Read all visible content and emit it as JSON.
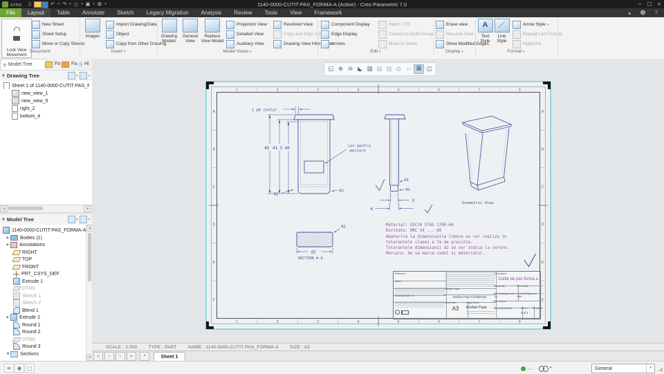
{
  "window": {
    "wordmark": "creo",
    "title": "1140-0000-CUTIT-PAS_FORMA-A (Active) - Creo Parametric 7.0"
  },
  "glyphs": {
    "dd": "▾",
    "up": "▴",
    "min": "─",
    "max": "□",
    "close": "×",
    "help": "?",
    "user": "☻",
    "page": "▯",
    "undo": "↶",
    "redo": "↷",
    "region": "◻",
    "windows": "▣",
    "mail": "⊠",
    "left": "◂",
    "right": "▸",
    "scroll_up": "▴",
    "scroll_down": "▾",
    "expand": "▶",
    "collapse": "▼",
    "nav_first": "«",
    "nav_prev": "‹",
    "nav_next": "›",
    "nav_last": "»",
    "plus": "+",
    "grip": "◢",
    "list": "≡",
    "globe": "◉",
    "box": "▢"
  },
  "tabs": [
    "File",
    "Layout",
    "Table",
    "Annotate",
    "Sketch",
    "Legacy Migration",
    "Analysis",
    "Review",
    "Tools",
    "View",
    "Framework"
  ],
  "ribbon": {
    "lock_view": "Lock View\nMovement",
    "document": {
      "label": "Document",
      "new_sheet": "New Sheet",
      "sheet_setup": "Sheet Setup",
      "move_copy": "Move or Copy Sheets"
    },
    "insert": {
      "label": "Insert",
      "images": "Images",
      "import": "Import Drawing/Data",
      "object": "Object",
      "copy_other": "Copy from Other Drawing"
    },
    "model_views": {
      "label": "Model Views",
      "drawing_models": "Drawing\nModels",
      "general_view": "General\nView",
      "replace_view": "Replace\nView Model",
      "projection": "Projection View",
      "detailed": "Detailed View",
      "auxiliary": "Auxiliary View",
      "revolved": "Revolved View",
      "copy_align": "Copy and Align View",
      "view_info": "Drawing View Information"
    },
    "edit": {
      "label": "Edit",
      "component_display": "Component Display",
      "edge_display": "Edge Display",
      "arrows": "Arrows",
      "hatch": "Hatch / Fill",
      "convert": "Convert to Draft Group",
      "move_sheet": "Move to Sheet"
    },
    "display": {
      "label": "Display",
      "erase": "Erase view",
      "resume": "Resume View",
      "modified": "Show Modified Edges"
    },
    "format": {
      "label": "Format",
      "text_style": "Text\nStyle",
      "line_style": "Line\nStyle",
      "arrow_style": "Arrow Style",
      "repeat": "Repeat Last Format",
      "hyperlink": "Hyperlink"
    }
  },
  "left_panel": {
    "tabs": {
      "model_tree": "Model Tree",
      "folders": "Fo",
      "favorites": "Fa",
      "history": "Hi"
    },
    "drawing_tree": {
      "header": "Drawing Tree",
      "root": "Sheet 1 of 1140-0000-CUTIT-PAS_FORMA-A",
      "items": [
        {
          "label": "new_view_1"
        },
        {
          "label": "new_view_5"
        },
        {
          "label": "right_2"
        },
        {
          "label": "bottom_4"
        }
      ]
    },
    "model_tree": {
      "header": "Model Tree",
      "root": "1140-0000-CUTIT-PAS_FORMA-A.PRT",
      "items": [
        {
          "label": "Bodies (1)"
        },
        {
          "label": "Annotations"
        },
        {
          "label": "RIGHT"
        },
        {
          "label": "TOP"
        },
        {
          "label": "FRONT"
        },
        {
          "label": "PRT_CSYS_DEF"
        },
        {
          "label": "Extrude 1"
        },
        {
          "label": "DTM1"
        },
        {
          "label": "Sketch 1"
        },
        {
          "label": "Sketch 2"
        },
        {
          "label": "Blend 1"
        },
        {
          "label": "Extrude 2"
        },
        {
          "label": "Round 1"
        },
        {
          "label": "Round 2"
        },
        {
          "label": "DTM3"
        },
        {
          "label": "Round 3"
        },
        {
          "label": "Sections"
        }
      ]
    }
  },
  "gfx_toolbar": [
    "◱",
    "⊕",
    "⊖",
    "◣",
    "▧",
    "▤",
    "▥",
    "◇",
    "▱",
    "▦",
    "◫"
  ],
  "drawing": {
    "zones_top": [
      "1",
      "2",
      "3",
      "4",
      "5",
      "6",
      "7",
      "8"
    ],
    "zones_side": [
      "A",
      "B",
      "C",
      "D",
      "E",
      "F"
    ],
    "front_view": {
      "dim_45": "45",
      "dim_41_5": "41.5",
      "dim_40": "40",
      "contour_note": "1 pe contur",
      "marking_line1": "Loc pentru",
      "marking_line2": "marcare",
      "r2_left": "R2",
      "r2_right": "R2"
    },
    "side_view": {
      "r1_upper": "R1",
      "r1_lower": "R1",
      "dim_3": "3",
      "dim_6": "6"
    },
    "iso_view": {
      "label": "Isometric View"
    },
    "section_view": {
      "label": "SECTION A-A",
      "dim_d2": "d2",
      "r1": "R1"
    },
    "notes": [
      "Material: OSC10 STAS 1700-60",
      "Duritate: HRC 54 ... 60",
      "Abaterile la dimensiunile libere se vor realiza in",
      "tolerantele clasei a 7a de precizie.",
      "Tolerantele dimensiunii d2 se vor indica la cerere.",
      "Marcare: Se va marca codul si materialul."
    ]
  },
  "title_block": {
    "reference_label": "Reference:",
    "notes_label": "Notes:",
    "scale_label": "Drawing Scale:",
    "scale_value": "1:1",
    "situation_label": "Situation Type:",
    "confidential": "Emilian Popa Confidential",
    "owner_label": "Legal Name:",
    "owner": "Emilian Popa",
    "sheet_size_label": "Sheet Size:",
    "sheet_size": "A3",
    "description_label": "Description:",
    "description": "Cutite de pas forma a",
    "drawn_by_label": "Drawn By:",
    "sheet_date_label": "Sheet Date:",
    "checked_label": "Checked/Approved by:",
    "checked_date_label": "Checked/Approved Date:",
    "part_name_label": "Part Name:",
    "drawing_number_label": "Drawing Number:",
    "sheet_label": "Sheet:",
    "sheet_value": "1 of 1",
    "revision_label": "Revision:"
  },
  "status_line": {
    "scale": "SCALE : 2.000",
    "type": "TYPE : PART",
    "name": "NAME : 1140-0000-CUTIT-PAS_FORMA-A",
    "size": "SIZE : A3"
  },
  "sheet_tabs": {
    "active": "Sheet 1"
  },
  "status_bar": {
    "filter": "General"
  }
}
